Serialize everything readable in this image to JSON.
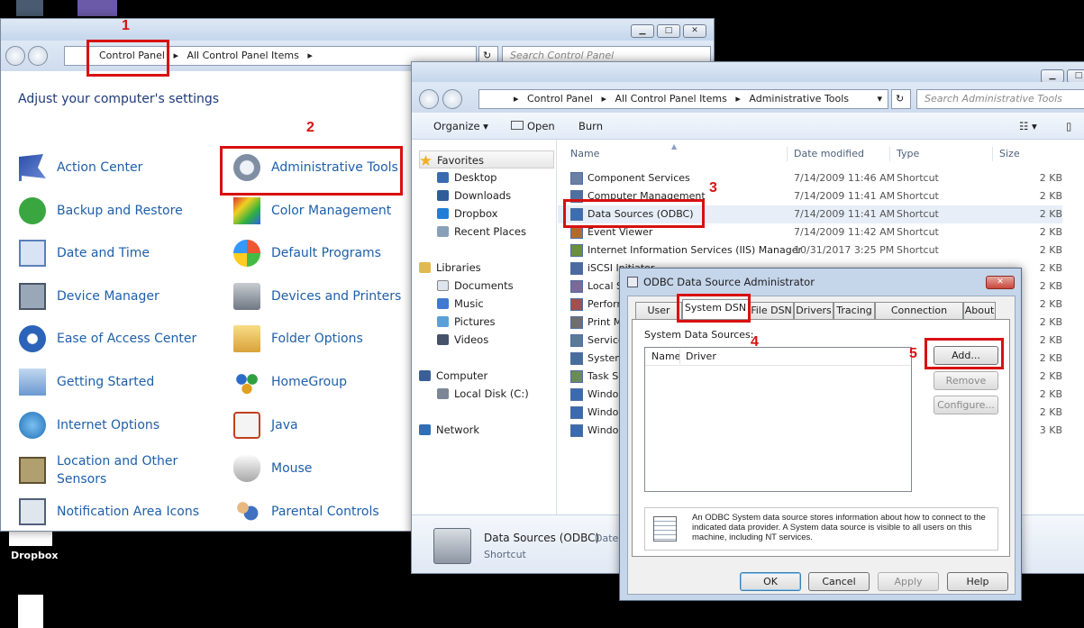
{
  "desktop": {
    "dropbox_label": "Dropbox"
  },
  "control_panel": {
    "breadcrumb": [
      "Control Panel",
      "All Control Panel Items"
    ],
    "search_placeholder": "Search Control Panel",
    "heading": "Adjust your computer's settings",
    "items_left": [
      "Action Center",
      "Backup and Restore",
      "Date and Time",
      "Device Manager",
      "Ease of Access Center",
      "Getting Started",
      "Internet Options",
      "Location and Other Sensors",
      "Notification Area Icons"
    ],
    "items_right": [
      "Administrative Tools",
      "Color Management",
      "Default Programs",
      "Devices and Printers",
      "Folder Options",
      "HomeGroup",
      "Java",
      "Mouse",
      "Parental Controls"
    ]
  },
  "explorer": {
    "breadcrumb": [
      "Control Panel",
      "All Control Panel Items",
      "Administrative Tools"
    ],
    "search_placeholder": "Search Administrative Tools",
    "toolbar": {
      "organize": "Organize",
      "open": "Open",
      "burn": "Burn"
    },
    "nav": {
      "favorites_label": "Favorites",
      "favorites": [
        "Desktop",
        "Downloads",
        "Dropbox",
        "Recent Places"
      ],
      "libraries_label": "Libraries",
      "libraries": [
        "Documents",
        "Music",
        "Pictures",
        "Videos"
      ],
      "computer_label": "Computer",
      "computer": [
        "Local Disk (C:)"
      ],
      "network_label": "Network"
    },
    "columns": [
      "Name",
      "Date modified",
      "Type",
      "Size"
    ],
    "files": [
      {
        "name": "Component Services",
        "date": "7/14/2009 11:46 AM",
        "type": "Shortcut",
        "size": "2 KB"
      },
      {
        "name": "Computer Management",
        "date": "7/14/2009 11:41 AM",
        "type": "Shortcut",
        "size": "2 KB"
      },
      {
        "name": "Data Sources (ODBC)",
        "date": "7/14/2009 11:41 AM",
        "type": "Shortcut",
        "size": "2 KB"
      },
      {
        "name": "Event Viewer",
        "date": "7/14/2009 11:42 AM",
        "type": "Shortcut",
        "size": "2 KB"
      },
      {
        "name": "Internet Information Services (IIS) Manager",
        "date": "10/31/2017 3:25 PM",
        "type": "Shortcut",
        "size": "2 KB"
      },
      {
        "name": "iSCSI Initiator",
        "date": "",
        "type": "",
        "size": "2 KB"
      },
      {
        "name": "Local S",
        "date": "",
        "type": "",
        "size": "2 KB"
      },
      {
        "name": "Perform",
        "date": "",
        "type": "",
        "size": "2 KB"
      },
      {
        "name": "Print M",
        "date": "",
        "type": "",
        "size": "2 KB"
      },
      {
        "name": "Service",
        "date": "",
        "type": "",
        "size": "2 KB"
      },
      {
        "name": "System",
        "date": "",
        "type": "",
        "size": "2 KB"
      },
      {
        "name": "Task Sc",
        "date": "",
        "type": "",
        "size": "2 KB"
      },
      {
        "name": "Windo",
        "date": "",
        "type": "",
        "size": "2 KB"
      },
      {
        "name": "Windo",
        "date": "",
        "type": "",
        "size": "2 KB"
      },
      {
        "name": "Windo",
        "date": "",
        "type": "",
        "size": "3 KB"
      }
    ],
    "details": {
      "name": "Data Sources (ODBC)",
      "date_label": "Date",
      "type": "Shortcut"
    }
  },
  "odbc_dialog": {
    "title": "ODBC Data Source Administrator",
    "tabs": [
      "User DSN",
      "System DSN",
      "File DSN",
      "Drivers",
      "Tracing",
      "Connection Pooling",
      "About"
    ],
    "list_label": "System Data Sources:",
    "list_columns": [
      "Name",
      "Driver"
    ],
    "side_buttons": [
      "Add...",
      "Remove",
      "Configure..."
    ],
    "info_text": "An ODBC System data source stores information about how to connect to the indicated data provider.   A System data source is visible to all users on this machine, including NT services.",
    "buttons": [
      "OK",
      "Cancel",
      "Apply",
      "Help"
    ]
  },
  "annotations": {
    "step1": "1",
    "step2": "2",
    "step3": "3",
    "step4": "4",
    "step5": "5"
  },
  "colors": {
    "annotation_red": "#d81010",
    "link_blue": "#1e5faa"
  }
}
